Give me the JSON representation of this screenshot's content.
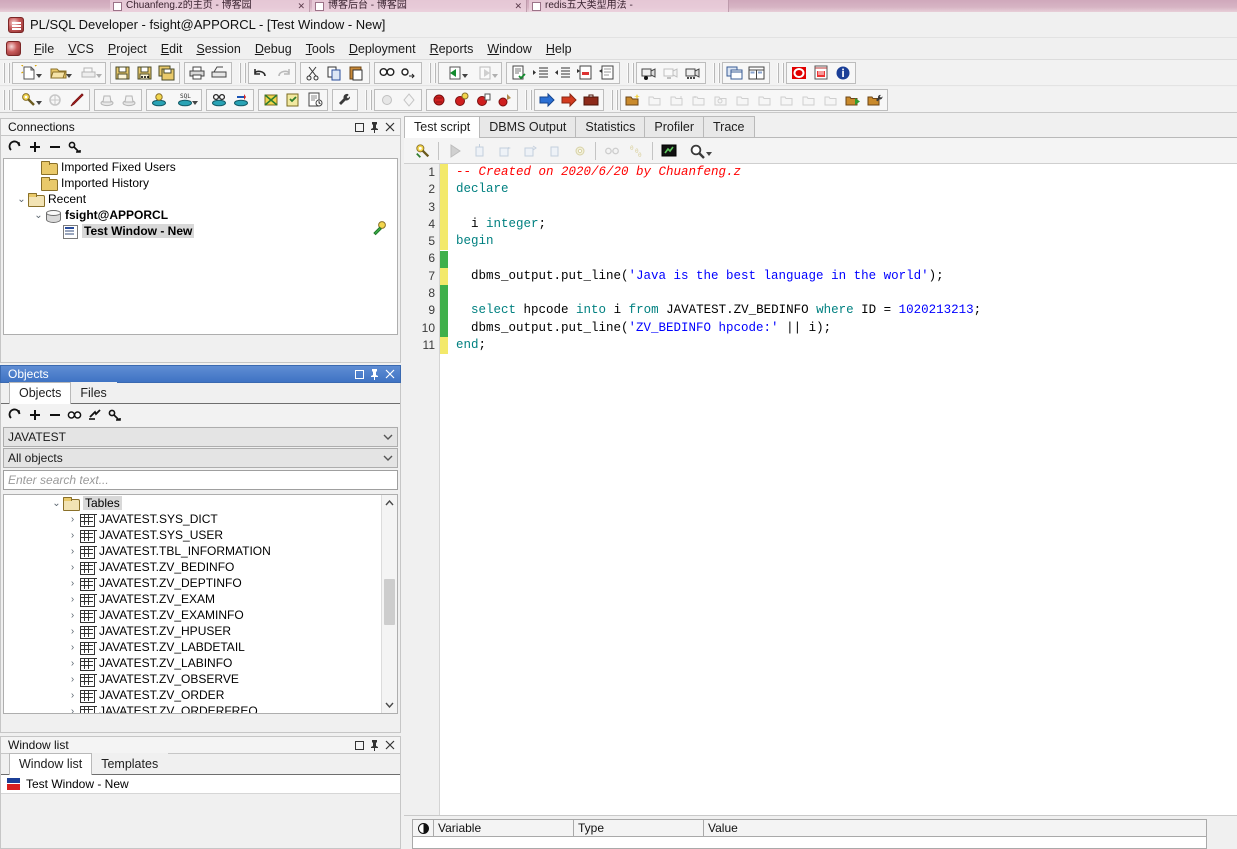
{
  "browser_tabs": [
    {
      "title": "Chuanfeng.z的主页 - 博客园",
      "close": "✕"
    },
    {
      "title": "博客后台 - 博客园",
      "close": "✕"
    },
    {
      "title": "redis五大类型用法 -",
      "close": ""
    }
  ],
  "window": {
    "title": "PL/SQL Developer - fsight@APPORCL - [Test Window - New]",
    "app_icon": "plsql-developer-icon"
  },
  "menu": {
    "items": [
      {
        "label": "File",
        "accel": "F"
      },
      {
        "label": "VCS",
        "accel": "V"
      },
      {
        "label": "Project",
        "accel": "P"
      },
      {
        "label": "Edit",
        "accel": "E"
      },
      {
        "label": "Session",
        "accel": "S"
      },
      {
        "label": "Debug",
        "accel": "D"
      },
      {
        "label": "Tools",
        "accel": "T"
      },
      {
        "label": "Deployment",
        "accel": "D"
      },
      {
        "label": "Reports",
        "accel": "R"
      },
      {
        "label": "Window",
        "accel": "W"
      },
      {
        "label": "Help",
        "accel": "H"
      }
    ]
  },
  "toolbar_row1": [
    {
      "name": "new-icon",
      "dropdown": true,
      "enabled": true
    },
    {
      "name": "open-folder-icon",
      "dropdown": true,
      "enabled": true
    },
    {
      "name": "print-preview-icon",
      "dropdown": true,
      "enabled": false
    },
    {
      "name": "save-icon",
      "enabled": true
    },
    {
      "name": "save-as-icon",
      "enabled": true
    },
    {
      "name": "save-all-icon",
      "enabled": true
    },
    {
      "name": "print-icon",
      "enabled": true
    },
    {
      "name": "print-setup-icon",
      "enabled": true
    },
    {
      "name": "undo-icon",
      "enabled": true
    },
    {
      "name": "redo-icon",
      "enabled": false
    },
    {
      "name": "cut-icon",
      "enabled": true
    },
    {
      "name": "copy-icon",
      "enabled": true
    },
    {
      "name": "paste-icon",
      "enabled": true
    },
    {
      "name": "find-icon",
      "enabled": true
    },
    {
      "name": "find-next-icon",
      "enabled": true
    },
    {
      "name": "back-icon",
      "dropdown": true,
      "enabled": true
    },
    {
      "name": "forward-icon",
      "dropdown": true,
      "enabled": false
    },
    {
      "name": "check-syntax-icon",
      "enabled": true
    },
    {
      "name": "indent-icon",
      "enabled": true
    },
    {
      "name": "outdent-icon",
      "enabled": true
    },
    {
      "name": "comment-icon",
      "enabled": true
    },
    {
      "name": "uncomment-icon",
      "enabled": true
    },
    {
      "name": "record-macro-icon",
      "enabled": true
    },
    {
      "name": "stop-macro-icon",
      "enabled": false
    },
    {
      "name": "play-macro-icon",
      "enabled": true
    },
    {
      "name": "window-list-icon",
      "enabled": true
    },
    {
      "name": "tile-windows-icon",
      "enabled": true
    },
    {
      "name": "stop-icon",
      "enabled": true
    },
    {
      "name": "export-pdf-icon",
      "enabled": true
    },
    {
      "name": "about-info-icon",
      "enabled": true
    }
  ],
  "toolbar_row2": [
    {
      "name": "explain-plan-icon",
      "dropdown": true,
      "enabled": true
    },
    {
      "name": "break-icon",
      "enabled": false
    },
    {
      "name": "kill-session-icon",
      "enabled": true
    },
    {
      "name": "commit-icon",
      "enabled": false
    },
    {
      "name": "rollback-icon",
      "enabled": false
    },
    {
      "name": "session-info-icon",
      "enabled": true
    },
    {
      "name": "sql-window-icon",
      "dropdown": true,
      "enabled": true
    },
    {
      "name": "find-database-objects-icon",
      "enabled": true
    },
    {
      "name": "refresh-session-icon",
      "enabled": true
    },
    {
      "name": "compile-invalid-icon",
      "enabled": true
    },
    {
      "name": "test-window-icon",
      "enabled": true
    },
    {
      "name": "report-window-icon",
      "enabled": true
    },
    {
      "name": "preferences-wrench-icon",
      "enabled": true
    },
    {
      "name": "breakpoint-disabled-icon",
      "enabled": false
    },
    {
      "name": "diamond-icon",
      "enabled": false
    },
    {
      "name": "breakpoint-red-icon",
      "enabled": true
    },
    {
      "name": "breakpoint-add-icon",
      "enabled": true
    },
    {
      "name": "breakpoint-toggle-icon",
      "enabled": true
    },
    {
      "name": "breakpoint-clear-icon",
      "enabled": true
    },
    {
      "name": "run-blue-arrow-icon",
      "enabled": true
    },
    {
      "name": "run-red-arrow-icon",
      "enabled": true
    },
    {
      "name": "briefcase-icon",
      "enabled": true
    },
    {
      "name": "open-project-icon",
      "enabled": true
    },
    {
      "name": "project-item1-icon",
      "enabled": false
    },
    {
      "name": "project-item2-icon",
      "enabled": false
    },
    {
      "name": "project-item3-icon",
      "enabled": false
    },
    {
      "name": "project-item4-icon",
      "enabled": false
    },
    {
      "name": "project-item5-icon",
      "enabled": false
    },
    {
      "name": "project-item6-icon",
      "enabled": false
    },
    {
      "name": "project-item7-icon",
      "enabled": false
    },
    {
      "name": "project-item8-icon",
      "enabled": false
    },
    {
      "name": "project-item9-icon",
      "enabled": false
    },
    {
      "name": "project-run-icon",
      "enabled": true
    },
    {
      "name": "project-config-icon",
      "enabled": true
    }
  ],
  "connections_panel": {
    "title": "Connections",
    "window_buttons": [
      "maximize-icon",
      "pin-icon",
      "close-icon"
    ],
    "toolbar": [
      "refresh-icon",
      "add-icon",
      "remove-icon",
      "connection-properties-icon"
    ],
    "tree": [
      {
        "label": "Imported Fixed Users",
        "icon": "folder-icon",
        "depth": 1,
        "expander": "",
        "bold": false
      },
      {
        "label": "Imported History",
        "icon": "folder-icon",
        "depth": 1,
        "expander": "",
        "bold": false
      },
      {
        "label": "Recent",
        "icon": "folder-open-icon",
        "depth": 1,
        "expander": "v",
        "bold": false
      },
      {
        "label": "fsight@APPORCL",
        "icon": "database-icon",
        "depth": 2,
        "expander": "v",
        "bold": true
      },
      {
        "label": "Test Window - New",
        "icon": "document-icon",
        "depth": 3,
        "expander": "",
        "bold": true,
        "selected": true
      }
    ],
    "status_icon": "green-key-icon"
  },
  "objects_panel": {
    "title": "Objects",
    "window_buttons": [
      "maximize-icon",
      "pin-icon",
      "close-icon"
    ],
    "tabs": [
      {
        "label": "Objects",
        "active": true
      },
      {
        "label": "Files",
        "active": false
      }
    ],
    "toolbar": [
      "refresh-icon",
      "add-icon",
      "remove-icon",
      "find-icon",
      "filter-icon",
      "object-properties-icon"
    ],
    "schema_select": {
      "value": "JAVATEST"
    },
    "filter_select": {
      "value": "All objects"
    },
    "search": {
      "placeholder": "Enter search text...",
      "value": ""
    },
    "tree_root": {
      "label": "Tables",
      "icon": "folder-open-icon",
      "expander": "v",
      "selected": true
    },
    "tables": [
      "JAVATEST.SYS_DICT",
      "JAVATEST.SYS_USER",
      "JAVATEST.TBL_INFORMATION",
      "JAVATEST.ZV_BEDINFO",
      "JAVATEST.ZV_DEPTINFO",
      "JAVATEST.ZV_EXAM",
      "JAVATEST.ZV_EXAMINFO",
      "JAVATEST.ZV_HPUSER",
      "JAVATEST.ZV_LABDETAIL",
      "JAVATEST.ZV_LABINFO",
      "JAVATEST.ZV_OBSERVE",
      "JAVATEST.ZV_ORDER",
      "JAVATEST.ZV_ORDERFREQ"
    ],
    "scroll": {
      "up": "⌃",
      "down": "⌄"
    }
  },
  "window_list_panel": {
    "title": "Window list",
    "window_buttons": [
      "maximize-icon",
      "pin-icon",
      "close-icon"
    ],
    "tabs": [
      {
        "label": "Window list",
        "active": true
      },
      {
        "label": "Templates",
        "active": false
      }
    ],
    "items": [
      {
        "label": "Test Window - New",
        "icon": "test-window-icon"
      }
    ]
  },
  "editor": {
    "tabs": [
      {
        "label": "Test script",
        "active": true
      },
      {
        "label": "DBMS Output",
        "active": false
      },
      {
        "label": "Statistics",
        "active": false
      },
      {
        "label": "Profiler",
        "active": false
      },
      {
        "label": "Trace",
        "active": false
      }
    ],
    "toolbar": [
      {
        "name": "debug-test-icon",
        "enabled": true
      },
      {
        "name": "run-play-icon",
        "enabled": false
      },
      {
        "name": "step-into-icon",
        "enabled": false
      },
      {
        "name": "step-over-icon",
        "enabled": false
      },
      {
        "name": "step-out-icon",
        "enabled": false
      },
      {
        "name": "run-to-exception-icon",
        "enabled": false
      },
      {
        "name": "settings-gear-icon",
        "enabled": false
      },
      {
        "name": "watch-glasses-icon",
        "enabled": false
      },
      {
        "name": "call-stack-icon",
        "enabled": false
      },
      {
        "name": "output-window-icon",
        "enabled": true
      },
      {
        "name": "zoom-icon",
        "enabled": true,
        "dropdown": true
      }
    ],
    "line_numbers": [
      1,
      2,
      3,
      4,
      5,
      6,
      7,
      8,
      9,
      10,
      11
    ],
    "lines": [
      {
        "n": 1,
        "tokens": [
          {
            "t": "-- Created on 2020/6/20 by Chuanfeng.z",
            "c": "c"
          }
        ]
      },
      {
        "n": 2,
        "tokens": [
          {
            "t": "declare",
            "c": "k"
          }
        ]
      },
      {
        "n": 3,
        "tokens": [
          {
            "t": "",
            "c": "p"
          }
        ]
      },
      {
        "n": 4,
        "tokens": [
          {
            "t": "  i ",
            "c": "p"
          },
          {
            "t": "integer",
            "c": "k"
          },
          {
            "t": ";",
            "c": "p"
          }
        ]
      },
      {
        "n": 5,
        "tokens": [
          {
            "t": "begin",
            "c": "k"
          }
        ]
      },
      {
        "n": 6,
        "tokens": [
          {
            "t": "",
            "c": "p"
          }
        ]
      },
      {
        "n": 7,
        "tokens": [
          {
            "t": "  dbms_output.put_line(",
            "c": "p"
          },
          {
            "t": "'Java is the best language in the world'",
            "c": "s"
          },
          {
            "t": ");",
            "c": "p"
          }
        ]
      },
      {
        "n": 8,
        "tokens": [
          {
            "t": "",
            "c": "p"
          }
        ]
      },
      {
        "n": 9,
        "tokens": [
          {
            "t": "  ",
            "c": "p"
          },
          {
            "t": "select",
            "c": "k"
          },
          {
            "t": " hpcode ",
            "c": "p"
          },
          {
            "t": "into",
            "c": "k"
          },
          {
            "t": " i ",
            "c": "p"
          },
          {
            "t": "from",
            "c": "k"
          },
          {
            "t": " JAVATEST.ZV_BEDINFO ",
            "c": "p"
          },
          {
            "t": "where",
            "c": "k"
          },
          {
            "t": " ID = ",
            "c": "p"
          },
          {
            "t": "1020213213",
            "c": "n"
          },
          {
            "t": ";",
            "c": "p"
          }
        ]
      },
      {
        "n": 10,
        "tokens": [
          {
            "t": "  dbms_output.put_line(",
            "c": "p"
          },
          {
            "t": "'ZV_BEDINFO hpcode:'",
            "c": "s"
          },
          {
            "t": " || i);",
            "c": "p"
          }
        ]
      },
      {
        "n": 11,
        "tokens": [
          {
            "t": "end",
            "c": "k"
          },
          {
            "t": ";",
            "c": "p"
          }
        ]
      }
    ],
    "changed_lines": [
      1,
      2,
      3,
      4,
      5,
      6,
      7,
      8,
      9,
      10,
      11
    ],
    "variable_grid": {
      "columns": [
        "",
        "Variable",
        "Type",
        "Value"
      ],
      "rows": []
    }
  },
  "colors": {
    "accent_blue": "#3f73c4",
    "comment_red": "#ff0000",
    "keyword_teal": "#008080",
    "string_blue": "#0000ff",
    "panel_bg": "#f0f0f0"
  }
}
